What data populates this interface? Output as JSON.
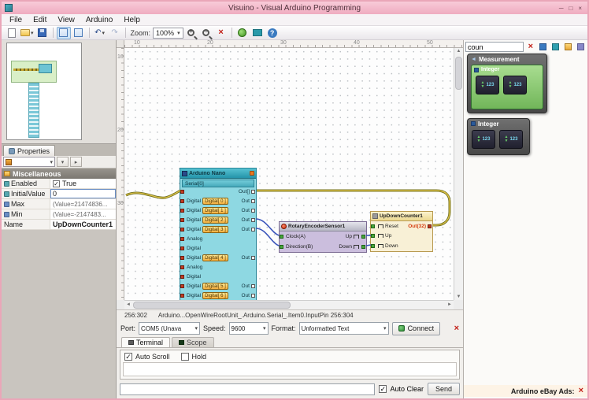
{
  "window": {
    "title": "Visuino - Visual Arduino Programming"
  },
  "menu": {
    "items": [
      "File",
      "Edit",
      "View",
      "Arduino",
      "Help"
    ]
  },
  "toolbar": {
    "zoom_label": "Zoom:",
    "zoom_value": "100%"
  },
  "properties": {
    "tab_label": "Properties",
    "group_label": "Miscellaneous",
    "rows": {
      "enabled": {
        "label": "Enabled",
        "value": "True",
        "checked": true
      },
      "initial_value": {
        "label": "InitialValue",
        "value": "0"
      },
      "max": {
        "label": "Max",
        "value": "(Value=21474836..."
      },
      "min": {
        "label": "Min",
        "value": "(Value=-2147483..."
      },
      "name": {
        "label": "Name",
        "value": "UpDownCounter1"
      }
    }
  },
  "canvas": {
    "ruler_h": [
      "10",
      "20",
      "30",
      "40",
      "50"
    ],
    "ruler_v": [
      "10",
      "20",
      "30"
    ],
    "status_position": "256:302",
    "status_path": "Arduino...OpenWireRootUnit_.Arduino.Serial_.Item0.InputPin 256:304"
  },
  "arduino": {
    "title": "Arduino Nano",
    "serial_label": "Serial[0]",
    "serial_out": "Out[]",
    "rows": [
      {
        "left": "Digital",
        "badge": "Digital[ 0 ]",
        "out": "Out"
      },
      {
        "left": "Digital",
        "badge": "Digital[ 1 ]",
        "out": "Out"
      },
      {
        "left": "Digital",
        "badge": "Digital[ 2 ]",
        "out": "Out"
      },
      {
        "left": "Digital",
        "badge": "Digital[ 3 ]",
        "out": "Out"
      },
      {
        "left": "Analog"
      },
      {
        "left": "Digital"
      },
      {
        "left": "Digital",
        "badge": "Digital[ 4 ]",
        "out": "Out"
      },
      {
        "left": "Analog"
      },
      {
        "left": "Digital"
      },
      {
        "left": "Digital",
        "badge": "Digital[ 5 ]",
        "out": "Out"
      },
      {
        "left": "Digital",
        "badge": "Digital[ 6 ]",
        "out": "Out"
      }
    ]
  },
  "encoder": {
    "title": "RotaryEncoderSensor1",
    "pin_clock": "Clock(A)",
    "pin_direction": "Direction(B)",
    "pin_up": "Up",
    "pin_down": "Down"
  },
  "counter": {
    "title": "UpDownCounter1",
    "pin_reset": "Reset",
    "pin_up": "Up",
    "pin_down": "Down",
    "pin_out": "Out(32)"
  },
  "connection": {
    "port_label": "Port:",
    "port_value": "COM5 (Unava",
    "speed_label": "Speed:",
    "speed_value": "9600",
    "format_label": "Format:",
    "format_value": "Unformatted Text",
    "connect_label": "Connect"
  },
  "terminal": {
    "tab_terminal": "Terminal",
    "tab_scope": "Scope",
    "auto_scroll_label": "Auto Scroll",
    "auto_scroll_checked": true,
    "hold_label": "Hold",
    "hold_checked": false,
    "auto_clear_label": "Auto Clear",
    "auto_clear_checked": true,
    "send_label": "Send",
    "output_text": "",
    "input_value": ""
  },
  "right_panel": {
    "search_value": "coun",
    "measurement": {
      "title": "Measurement",
      "sub_title": "Integer"
    },
    "integer": {
      "title": "Integer"
    },
    "ads_label": "Arduino eBay Ads:"
  },
  "colors": {
    "titlebar_pink": "#efacc0",
    "arduino_header": "#2494aa",
    "arduino_body": "#8ed8e2",
    "encoder_body": "#cbbedd",
    "counter_body": "#f8f0d6",
    "wire_gold": "#e6c84a",
    "wire_blue": "#3b55bb",
    "pin_red": "#c23b22",
    "pin_green": "#47a63a",
    "accent_red": "#c22018"
  }
}
